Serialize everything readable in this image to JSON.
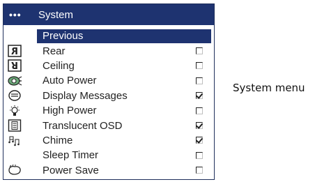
{
  "menu": {
    "header_dots": "•••",
    "title": "System",
    "items": [
      {
        "label": "Previous",
        "icon": "none",
        "checkbox": "none",
        "selected": true
      },
      {
        "label": "Rear",
        "icon": "rear-projection-icon",
        "checkbox": "unchecked"
      },
      {
        "label": "Ceiling",
        "icon": "ceiling-mount-icon",
        "checkbox": "unchecked"
      },
      {
        "label": "Auto Power",
        "icon": "auto-power-icon",
        "checkbox": "unchecked"
      },
      {
        "label": "Display Messages",
        "icon": "display-messages-icon",
        "checkbox": "checked"
      },
      {
        "label": "High Power",
        "icon": "high-power-lamp-icon",
        "checkbox": "unchecked"
      },
      {
        "label": "Translucent OSD",
        "icon": "translucent-osd-icon",
        "checkbox": "checked"
      },
      {
        "label": "Chime",
        "icon": "chime-music-icon",
        "checkbox": "checked"
      },
      {
        "label": "Sleep Timer",
        "icon": "none",
        "checkbox": "unchecked"
      },
      {
        "label": "Power Save",
        "icon": "power-save-icon",
        "checkbox": "unchecked"
      }
    ]
  },
  "caption": "System menu",
  "colors": {
    "title_bar": "#1e3370",
    "selected_row": "#1e3370",
    "text": "#222222"
  }
}
